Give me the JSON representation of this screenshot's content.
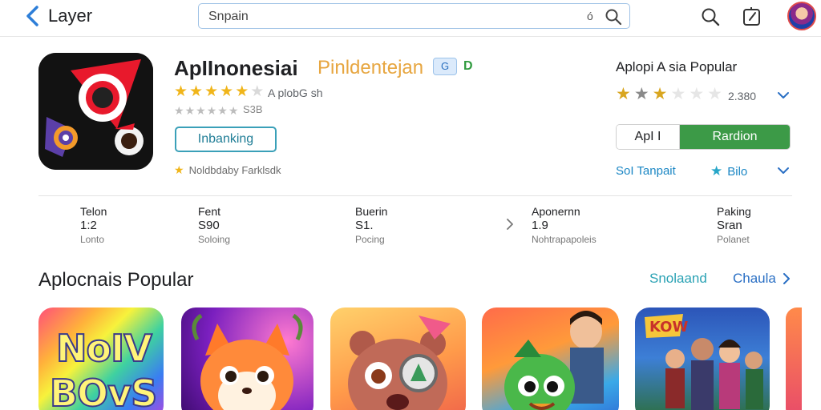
{
  "topbar": {
    "back_label": "Layer",
    "search_value": "Snpain",
    "search_clear": "ó"
  },
  "app": {
    "title": "ApIInonesiai",
    "developer": "Pinldentejan",
    "badge": "G",
    "badge2": "D",
    "rating_stars": 4.5,
    "rating_text": "A plobG sh",
    "rating2_text": "S3B",
    "install_label": "Inbanking",
    "featured_text": "Noldbdaby Farklsdk"
  },
  "right_panel": {
    "title": "Aplopi A sia Popular",
    "rating_count": "2.380",
    "button_left": "ApI I",
    "button_right": "Rardion",
    "link": "SoI Tanpait",
    "save_label": "Bilo"
  },
  "stats": [
    {
      "line1": "Telon",
      "line2": "1:2",
      "line3": "Lonto"
    },
    {
      "line1": "Fent",
      "line2": "S90",
      "line3": "Soloing"
    },
    {
      "line1": "Buerin",
      "line2": "S1.",
      "line3": "Pocing"
    },
    {
      "line1": "Aponernn",
      "line2": "1.9",
      "line3": "Nohtrapapoleis"
    },
    {
      "line1": "Paking",
      "line2": "Sran",
      "line3": "Polanet"
    }
  ],
  "section": {
    "title": "Aplocnais Popular",
    "link1": "Snolaand",
    "link2": "Chaula"
  },
  "tiles": [
    {
      "line1": "NoIV",
      "line2": "BOvS"
    },
    {},
    {},
    {},
    {
      "banner": "KOW"
    }
  ],
  "colors": {
    "accent_teal": "#2aa2b4",
    "install_green": "#3c9a47",
    "star_gold": "#f0b51a",
    "link_blue": "#1a86c4",
    "developer_orange": "#e7a640"
  }
}
